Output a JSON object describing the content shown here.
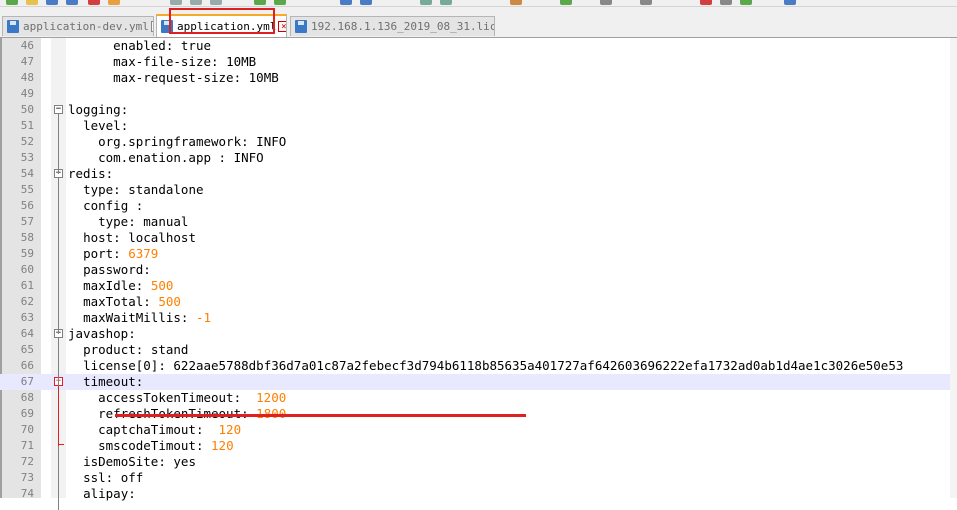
{
  "tabs": [
    {
      "label": "application-dev.yml",
      "active": false
    },
    {
      "label": "application.yml",
      "active": true
    },
    {
      "label": "192.168.1.136_2019_08_31.lic",
      "active": false
    }
  ],
  "close_glyph": "×",
  "fold_collapse_glyph": "−",
  "lines": [
    {
      "n": "46",
      "indent": "      ",
      "key": "enabled",
      "sep": ": ",
      "val": "true",
      "type": "str"
    },
    {
      "n": "47",
      "indent": "      ",
      "key": "max-file-size",
      "sep": ": ",
      "val": "10MB",
      "type": "str"
    },
    {
      "n": "48",
      "indent": "      ",
      "key": "max-request-size",
      "sep": ": ",
      "val": "10MB",
      "type": "str"
    },
    {
      "n": "49",
      "indent": "",
      "key": "",
      "sep": "",
      "val": "",
      "type": "str"
    },
    {
      "n": "50",
      "indent": "",
      "key": "logging",
      "sep": ":",
      "val": "",
      "type": "str"
    },
    {
      "n": "51",
      "indent": "  ",
      "key": "level",
      "sep": ":",
      "val": "",
      "type": "str"
    },
    {
      "n": "52",
      "indent": "    ",
      "key": "org.springframework",
      "sep": ": ",
      "val": "INFO",
      "type": "str"
    },
    {
      "n": "53",
      "indent": "    ",
      "key": "com.enation.app ",
      "sep": ": ",
      "val": "INFO",
      "type": "str"
    },
    {
      "n": "54",
      "indent": "",
      "key": "redis",
      "sep": ":",
      "val": "",
      "type": "str"
    },
    {
      "n": "55",
      "indent": "  ",
      "key": "type",
      "sep": ": ",
      "val": "standalone",
      "type": "str"
    },
    {
      "n": "56",
      "indent": "  ",
      "key": "config ",
      "sep": ":",
      "val": "",
      "type": "str"
    },
    {
      "n": "57",
      "indent": "    ",
      "key": "type",
      "sep": ": ",
      "val": "manual",
      "type": "str"
    },
    {
      "n": "58",
      "indent": "  ",
      "key": "host",
      "sep": ": ",
      "val": "localhost",
      "type": "str"
    },
    {
      "n": "59",
      "indent": "  ",
      "key": "port",
      "sep": ": ",
      "val": "6379",
      "type": "num"
    },
    {
      "n": "60",
      "indent": "  ",
      "key": "password",
      "sep": ":",
      "val": "",
      "type": "str"
    },
    {
      "n": "61",
      "indent": "  ",
      "key": "maxIdle",
      "sep": ": ",
      "val": "500",
      "type": "num"
    },
    {
      "n": "62",
      "indent": "  ",
      "key": "maxTotal",
      "sep": ": ",
      "val": "500",
      "type": "num"
    },
    {
      "n": "63",
      "indent": "  ",
      "key": "maxWaitMillis",
      "sep": ": ",
      "val": "-1",
      "type": "num"
    },
    {
      "n": "64",
      "indent": "",
      "key": "javashop",
      "sep": ":",
      "val": "",
      "type": "str"
    },
    {
      "n": "65",
      "indent": "  ",
      "key": "product",
      "sep": ": ",
      "val": "stand",
      "type": "str"
    },
    {
      "n": "66",
      "indent": "  ",
      "key": "license[0]",
      "sep": ": ",
      "val": "622aae5788dbf36d7a01c87a2febecf3d794b6118b85635a401727af642603696222efa1732ad0ab1d4ae1c3026e50e53",
      "type": "str"
    },
    {
      "n": "67",
      "indent": "  ",
      "key": "timeout",
      "sep": ":",
      "val": "",
      "type": "str"
    },
    {
      "n": "68",
      "indent": "    ",
      "key": "accessTokenTimeout",
      "sep": ":  ",
      "val": "1200",
      "type": "num"
    },
    {
      "n": "69",
      "indent": "    ",
      "key": "refreshTokenTimeout",
      "sep": ": ",
      "val": "1800",
      "type": "num"
    },
    {
      "n": "70",
      "indent": "    ",
      "key": "captchaTimout",
      "sep": ":  ",
      "val": "120",
      "type": "num"
    },
    {
      "n": "71",
      "indent": "    ",
      "key": "smscodeTimout",
      "sep": ": ",
      "val": "120",
      "type": "num"
    },
    {
      "n": "72",
      "indent": "  ",
      "key": "isDemoSite",
      "sep": ": ",
      "val": "yes",
      "type": "str"
    },
    {
      "n": "73",
      "indent": "  ",
      "key": "ssl",
      "sep": ": ",
      "val": "off",
      "type": "str"
    },
    {
      "n": "74",
      "indent": "  ",
      "key": "alipay",
      "sep": ":",
      "val": "",
      "type": "str"
    }
  ],
  "colors": {
    "number": "#ff8000",
    "highlight_box": "#e02020",
    "current_line": "#e8e8ff",
    "line_number": "#808080",
    "tab_accent": "#f7a928"
  },
  "current_line": "67"
}
